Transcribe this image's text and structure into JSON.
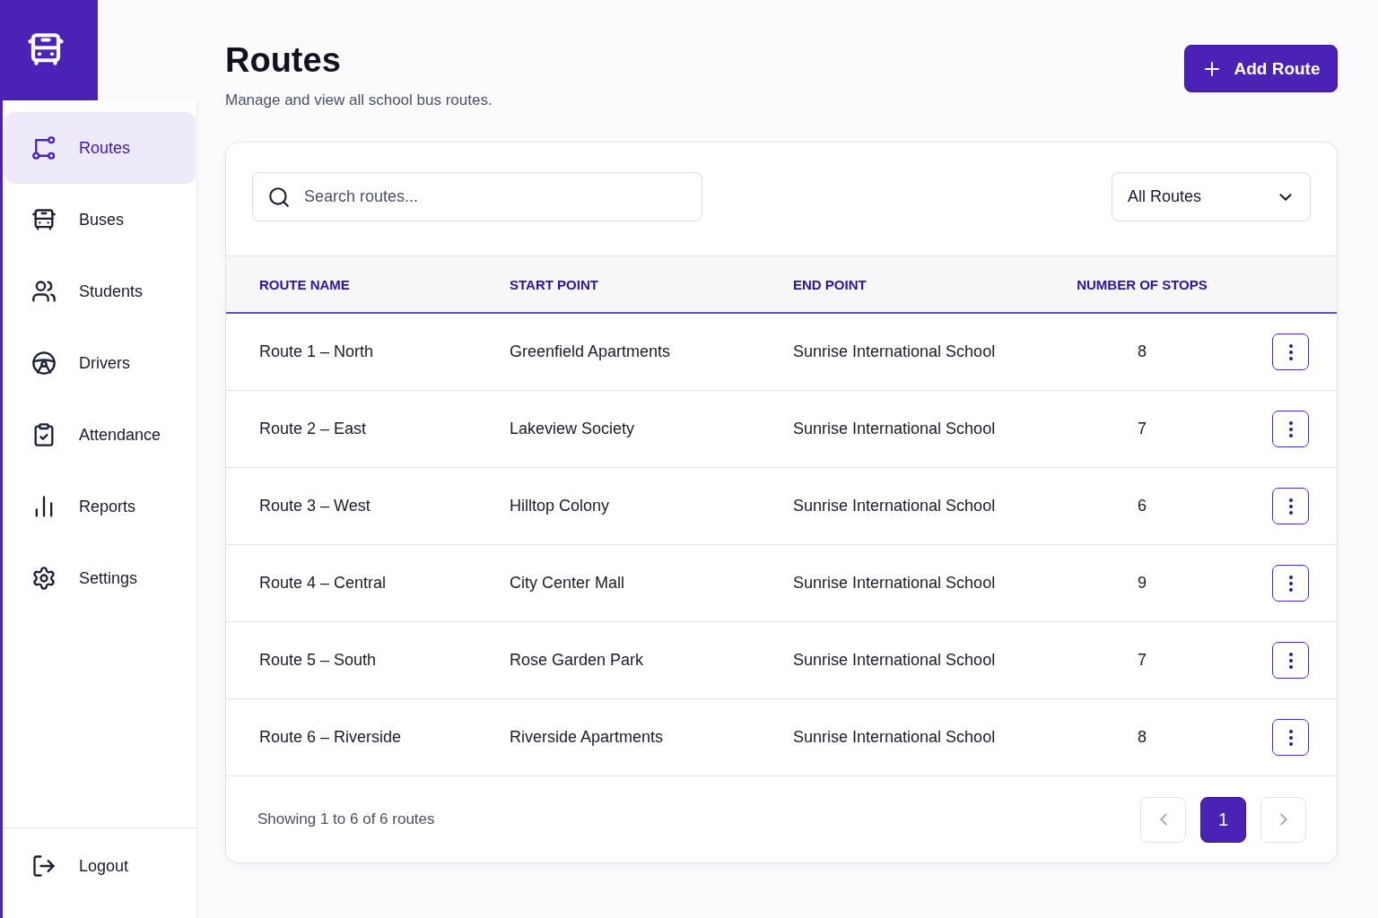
{
  "sidebar": {
    "items": [
      {
        "label": "Routes",
        "selected": true
      },
      {
        "label": "Buses",
        "selected": false
      },
      {
        "label": "Students",
        "selected": false
      },
      {
        "label": "Drivers",
        "selected": false
      },
      {
        "label": "Attendance",
        "selected": false
      },
      {
        "label": "Reports",
        "selected": false
      },
      {
        "label": "Settings",
        "selected": false
      }
    ],
    "logout": {
      "label": "Logout"
    }
  },
  "header": {
    "title": "Routes",
    "subtitle": "Manage and view all school bus routes.",
    "add_button": {
      "label": "Add Route"
    }
  },
  "toolbar": {
    "search": {
      "placeholder": "Search routes..."
    },
    "filter": {
      "value": "All Routes"
    }
  },
  "table": {
    "columns": [
      "ROUTE NAME",
      "START POINT",
      "END POINT",
      "NUMBER OF STOPS"
    ],
    "rows": [
      {
        "route_name": "Route 1 – North",
        "start_point": "Greenfield Apartments",
        "end_point": "Sunrise International School",
        "stops": "8"
      },
      {
        "route_name": "Route 2 – East",
        "start_point": "Lakeview Society",
        "end_point": "Sunrise International School",
        "stops": "7"
      },
      {
        "route_name": "Route 3 – West",
        "start_point": "Hilltop Colony",
        "end_point": "Sunrise International School",
        "stops": "6"
      },
      {
        "route_name": "Route 4 – Central",
        "start_point": "City Center Mall",
        "end_point": "Sunrise International School",
        "stops": "9"
      },
      {
        "route_name": "Route 5 – South",
        "start_point": "Rose Garden Park",
        "end_point": "Sunrise International School",
        "stops": "7"
      },
      {
        "route_name": "Route 6 – Riverside",
        "start_point": "Riverside Apartments",
        "end_point": "Sunrise International School",
        "stops": "8"
      }
    ]
  },
  "footer": {
    "summary": "Showing 1 to 6 of 6 routes",
    "pagination": {
      "previous": {
        "disabled": true
      },
      "pages": [
        {
          "label": "1",
          "selected": true
        }
      ],
      "next": {
        "disabled": true
      }
    }
  }
}
